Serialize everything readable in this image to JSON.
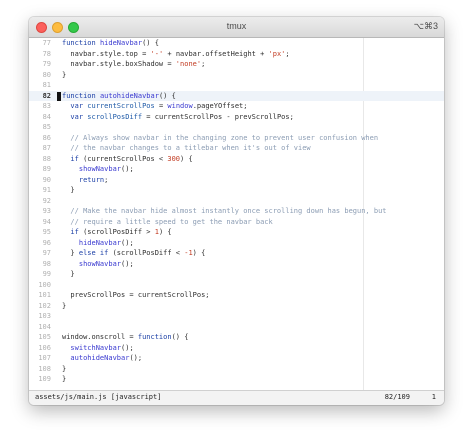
{
  "window": {
    "title": "tmux",
    "shortcut": "⌥⌘3"
  },
  "editor": {
    "current_line": "82",
    "lines": [
      {
        "n": "77",
        "segs": [
          [
            "kw",
            "function "
          ],
          [
            "fn",
            "hideNavbar"
          ],
          [
            "",
            "() {"
          ]
        ]
      },
      {
        "n": "78",
        "segs": [
          [
            "",
            "  navbar.style.top = "
          ],
          [
            "str",
            "'-'"
          ],
          [
            "",
            " + navbar.offsetHeight + "
          ],
          [
            "str",
            "'px'"
          ],
          [
            "",
            ";"
          ]
        ]
      },
      {
        "n": "79",
        "segs": [
          [
            "",
            "  navbar.style.boxShadow = "
          ],
          [
            "str",
            "'none'"
          ],
          [
            "",
            ";"
          ]
        ]
      },
      {
        "n": "80",
        "segs": [
          [
            "",
            "}"
          ]
        ]
      },
      {
        "n": "81",
        "segs": []
      },
      {
        "n": "82",
        "segs": [
          [
            "kw",
            "function "
          ],
          [
            "fn",
            "autohideNavbar"
          ],
          [
            "",
            "() {"
          ]
        ]
      },
      {
        "n": "83",
        "segs": [
          [
            "kw",
            "  var "
          ],
          [
            "vr",
            "currentScrollPos"
          ],
          [
            "",
            " = "
          ],
          [
            "fn",
            "window"
          ],
          [
            "",
            ".pageYOffset;"
          ]
        ]
      },
      {
        "n": "84",
        "segs": [
          [
            "kw",
            "  var "
          ],
          [
            "vr",
            "scrollPosDiff"
          ],
          [
            "",
            " = currentScrollPos - prevScrollPos;"
          ]
        ]
      },
      {
        "n": "85",
        "segs": []
      },
      {
        "n": "86",
        "segs": [
          [
            "cm",
            "  // Always show navbar in the changing zone to prevent user confusion when"
          ]
        ]
      },
      {
        "n": "87",
        "segs": [
          [
            "cm",
            "  // the navbar changes to a titlebar when it's out of view"
          ]
        ]
      },
      {
        "n": "88",
        "segs": [
          [
            "kw",
            "  if "
          ],
          [
            "",
            "(currentScrollPos < "
          ],
          [
            "num",
            "300"
          ],
          [
            "",
            ") {"
          ]
        ]
      },
      {
        "n": "89",
        "segs": [
          [
            "fn",
            "    showNavbar"
          ],
          [
            "",
            "();"
          ]
        ]
      },
      {
        "n": "90",
        "segs": [
          [
            "kw",
            "    return"
          ],
          [
            "",
            ";"
          ]
        ]
      },
      {
        "n": "91",
        "segs": [
          [
            "",
            "  }"
          ]
        ]
      },
      {
        "n": "92",
        "segs": []
      },
      {
        "n": "93",
        "segs": [
          [
            "cm",
            "  // Make the navbar hide almost instantly once scrolling down has begun, but"
          ]
        ]
      },
      {
        "n": "94",
        "segs": [
          [
            "cm",
            "  // require a little speed to get the navbar back"
          ]
        ]
      },
      {
        "n": "95",
        "segs": [
          [
            "kw",
            "  if "
          ],
          [
            "",
            "(scrollPosDiff > "
          ],
          [
            "num",
            "1"
          ],
          [
            "",
            ") {"
          ]
        ]
      },
      {
        "n": "96",
        "segs": [
          [
            "fn",
            "    hideNavbar"
          ],
          [
            "",
            "();"
          ]
        ]
      },
      {
        "n": "97",
        "segs": [
          [
            "",
            "  } "
          ],
          [
            "kw",
            "else if "
          ],
          [
            "",
            "(scrollPosDiff < "
          ],
          [
            "num",
            "-1"
          ],
          [
            "",
            ") {"
          ]
        ]
      },
      {
        "n": "98",
        "segs": [
          [
            "fn",
            "    showNavbar"
          ],
          [
            "",
            "();"
          ]
        ]
      },
      {
        "n": "99",
        "segs": [
          [
            "",
            "  }"
          ]
        ]
      },
      {
        "n": "100",
        "segs": []
      },
      {
        "n": "101",
        "segs": [
          [
            "",
            "  prevScrollPos = currentScrollPos;"
          ]
        ]
      },
      {
        "n": "102",
        "segs": [
          [
            "",
            "}"
          ]
        ]
      },
      {
        "n": "103",
        "segs": []
      },
      {
        "n": "104",
        "segs": []
      },
      {
        "n": "105",
        "segs": [
          [
            "",
            "window.onscroll = "
          ],
          [
            "kw",
            "function"
          ],
          [
            "",
            "() {"
          ]
        ]
      },
      {
        "n": "106",
        "segs": [
          [
            "fn",
            "  switchNavbar"
          ],
          [
            "",
            "();"
          ]
        ]
      },
      {
        "n": "107",
        "segs": [
          [
            "fn",
            "  autohideNavbar"
          ],
          [
            "",
            "();"
          ]
        ]
      },
      {
        "n": "108",
        "segs": [
          [
            "",
            "}"
          ]
        ]
      },
      {
        "n": "109",
        "segs": [
          [
            "",
            "}"
          ]
        ]
      }
    ]
  },
  "statusbar": {
    "file": "assets/js/main.js [javascript]",
    "position": "82/109",
    "column": "1"
  },
  "colors": {
    "keyword": "#1b3fa6",
    "string": "#c23b22",
    "comment": "#8b9cb3"
  }
}
